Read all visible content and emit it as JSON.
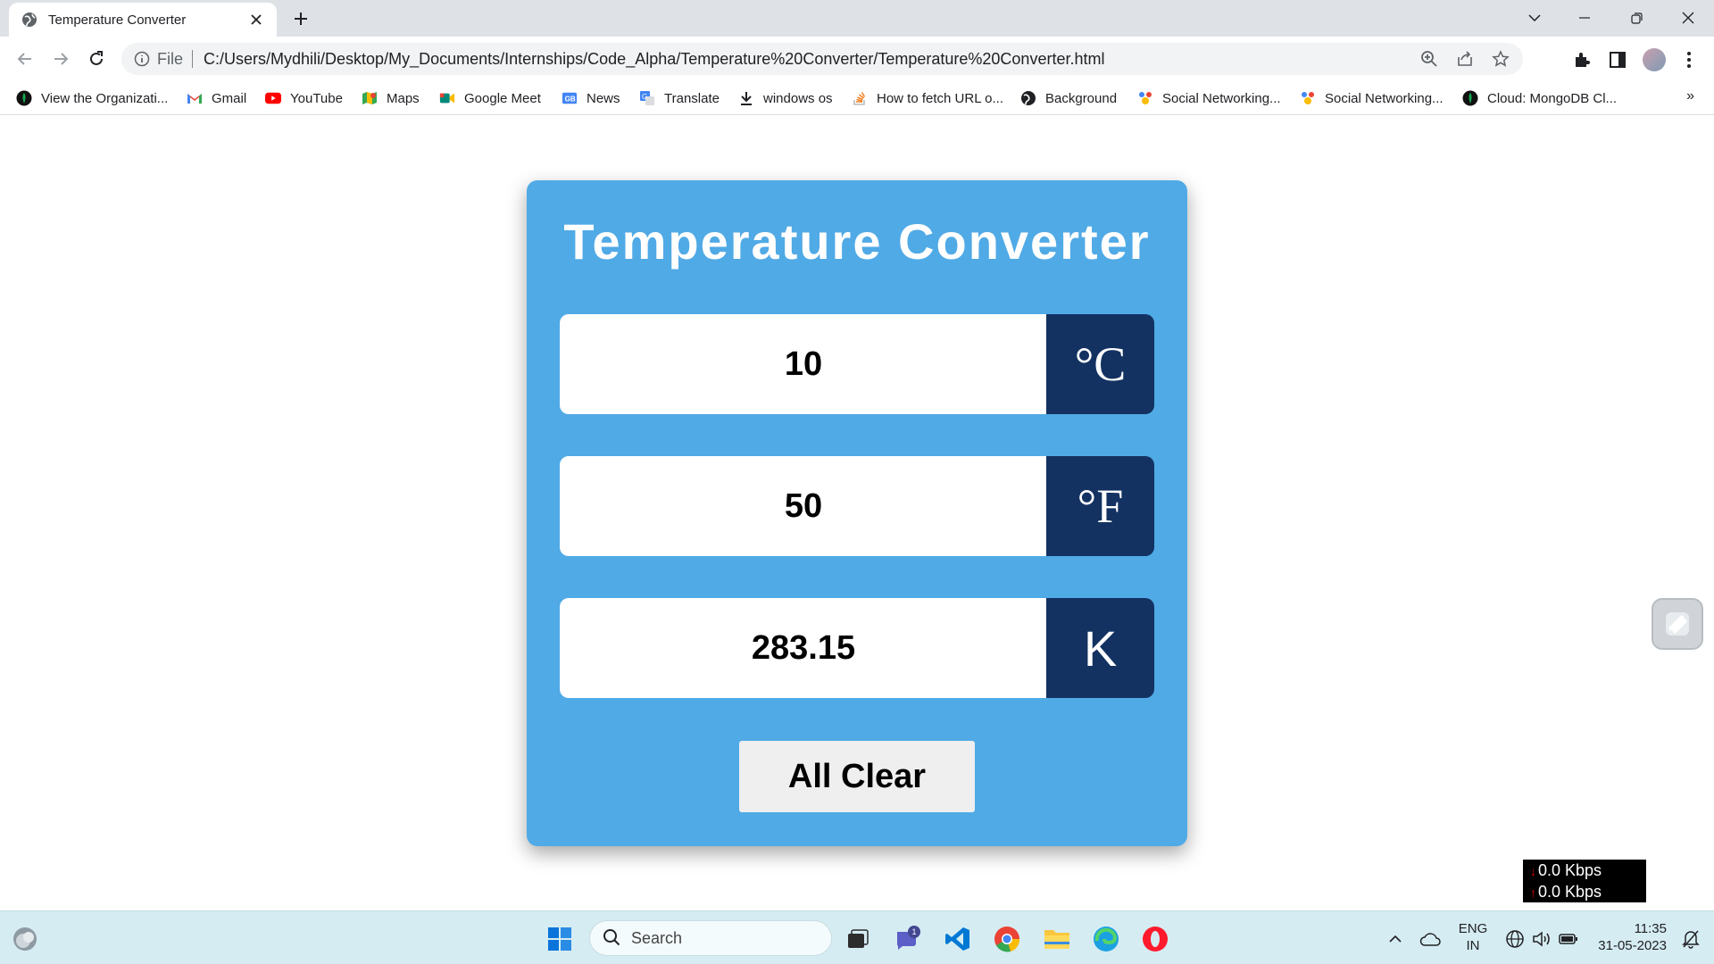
{
  "browser": {
    "tab_title": "Temperature Converter",
    "url_scheme": "File",
    "url": "C:/Users/Mydhili/Desktop/My_Documents/Internships/Code_Alpha/Temperature%20Converter/Temperature%20Converter.html"
  },
  "bookmarks": [
    {
      "label": "View the Organizati...",
      "icon": "mongodb-leaf-icon"
    },
    {
      "label": "Gmail",
      "icon": "gmail-icon"
    },
    {
      "label": "YouTube",
      "icon": "youtube-icon"
    },
    {
      "label": "Maps",
      "icon": "maps-icon"
    },
    {
      "label": "Google Meet",
      "icon": "meet-icon"
    },
    {
      "label": "News",
      "icon": "news-icon"
    },
    {
      "label": "Translate",
      "icon": "translate-icon"
    },
    {
      "label": "windows os",
      "icon": "download-icon"
    },
    {
      "label": "How to fetch URL o...",
      "icon": "stackoverflow-icon"
    },
    {
      "label": "Background",
      "icon": "globe-icon"
    },
    {
      "label": "Social Networking...",
      "icon": "social-icon"
    },
    {
      "label": "Social Networking...",
      "icon": "social-icon"
    },
    {
      "label": "Cloud: MongoDB Cl...",
      "icon": "mongodb-leaf-icon"
    }
  ],
  "converter": {
    "title": "Temperature Converter",
    "celsius": {
      "value": "10",
      "unit": "°C"
    },
    "fahrenheit": {
      "value": "50",
      "unit": "°F"
    },
    "kelvin": {
      "value": "283.15",
      "unit": "K"
    },
    "clear_label": "All Clear",
    "colors": {
      "card": "#50aae6",
      "unit_bg": "#133262",
      "button": "#efefef"
    }
  },
  "net_meter": {
    "down": "0.0 Kbps",
    "up": "0.0 Kbps"
  },
  "taskbar": {
    "search_placeholder": "Search",
    "chat_badge": "1",
    "lang": "ENG",
    "region": "IN",
    "time": "11:35",
    "date": "31-05-2023"
  }
}
